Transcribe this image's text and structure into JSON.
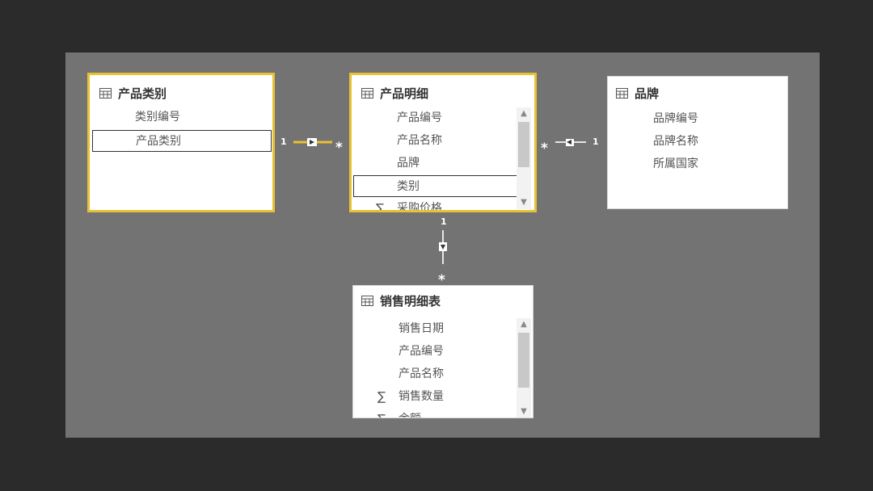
{
  "tables": {
    "category": {
      "title": "产品类别",
      "fields": [
        "类别编号",
        "产品类别"
      ]
    },
    "product": {
      "title": "产品明细",
      "fields": [
        "产品编号",
        "产品名称",
        "品牌",
        "类别",
        "采购价格"
      ]
    },
    "brand": {
      "title": "品牌",
      "fields": [
        "品牌编号",
        "品牌名称",
        "所属国家"
      ]
    },
    "sales": {
      "title": "销售明细表",
      "fields": [
        "销售日期",
        "产品编号",
        "产品名称",
        "销售数量",
        "金额"
      ]
    }
  },
  "relationships": {
    "category_product": {
      "one": "1",
      "many": "*"
    },
    "brand_product": {
      "one": "1",
      "many": "*"
    },
    "product_sales": {
      "one": "1",
      "many": "*"
    }
  },
  "colors": {
    "selected_border": "#e8c233",
    "canvas": "#737373",
    "frame": "#2b2b2b"
  },
  "icons": {
    "table": "table-grid-icon",
    "sigma": "sigma-icon"
  }
}
